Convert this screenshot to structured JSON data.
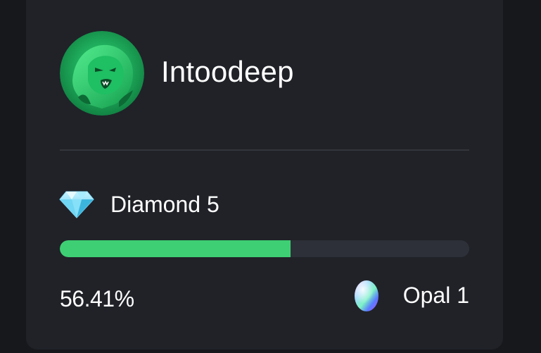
{
  "profile": {
    "username": "Intoodeep",
    "avatar_icon": "lion-avatar-icon",
    "accent": "#3ecf74"
  },
  "rank": {
    "current_label": "Diamond 5",
    "current_icon": "diamond-icon",
    "progress_percent": 56.41,
    "progress_text": "56.41%",
    "next_label": "Opal 1",
    "next_icon": "opal-gem-icon",
    "fill_color": "#3ecf74",
    "track_color": "#2d3038"
  }
}
